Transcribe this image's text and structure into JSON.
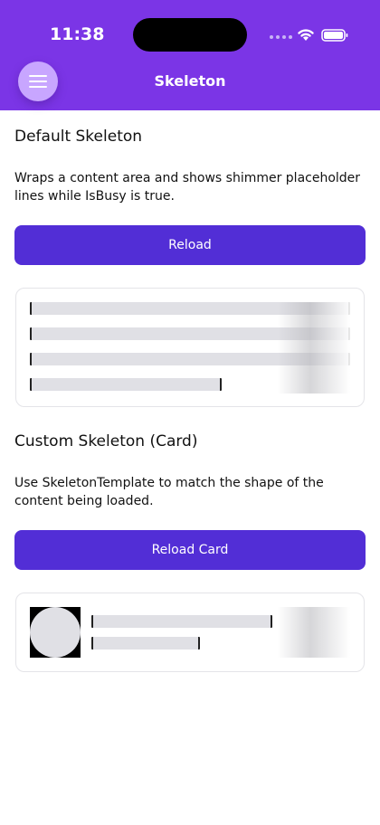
{
  "status_bar": {
    "time": "11:38"
  },
  "header": {
    "title": "Skeleton"
  },
  "default_section": {
    "title": "Default Skeleton",
    "description": "Wraps a content area and shows shimmer placeholder lines while IsBusy is true.",
    "button_label": "Reload"
  },
  "custom_section": {
    "title": "Custom Skeleton (Card)",
    "description": "Use SkeletonTemplate to match the shape of the content being loaded.",
    "button_label": "Reload Card"
  },
  "colors": {
    "header": "#7b35e6",
    "button": "#522ed6",
    "placeholder": "#e0e0e5",
    "menu_button": "#c8a6ff"
  }
}
